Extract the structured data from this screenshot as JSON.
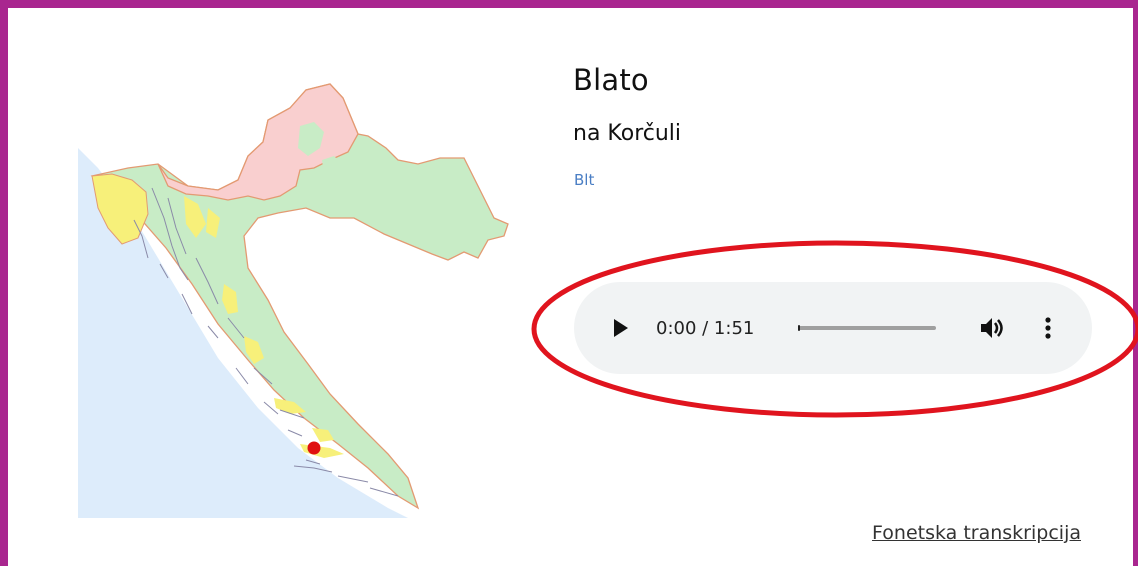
{
  "location": {
    "name": "Blato",
    "subtitle": "na Korčuli",
    "code": "Blt"
  },
  "audio_player": {
    "time_display": "0:00 / 1:51",
    "progress": 0.0,
    "play_icon": "play-icon",
    "volume_icon": "volume-icon",
    "menu_icon": "more-vert-icon"
  },
  "links": {
    "transcription": "Fonetska transkripcija"
  },
  "colors": {
    "frame": "#a9268f",
    "highlight_ellipse": "#e0141e",
    "map_red_dialect": "#f9cfcf",
    "map_green_dialect": "#c8ecc6",
    "map_yellow_dialect": "#f7f07a",
    "sea": "#ddecfb",
    "location_dot": "#e01010"
  }
}
